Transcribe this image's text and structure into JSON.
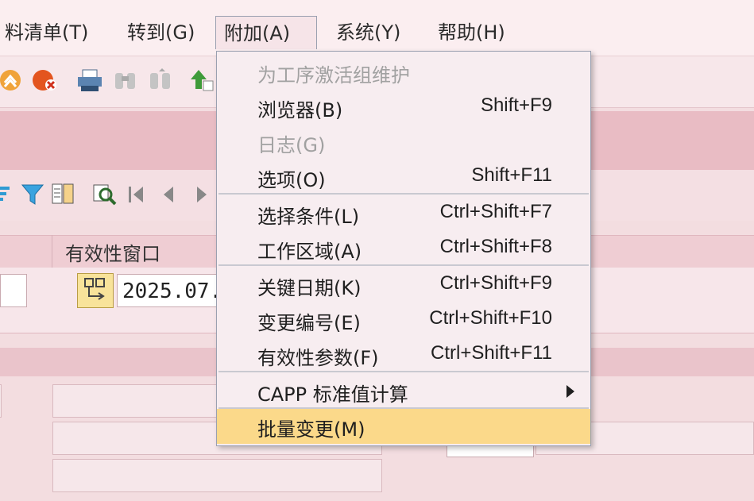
{
  "menubar": {
    "items": [
      {
        "label": "料清单(T)"
      },
      {
        "label": "转到(G)"
      },
      {
        "label": "附加(A)"
      },
      {
        "label": "系统(Y)"
      },
      {
        "label": "帮助(H)"
      }
    ]
  },
  "header": {
    "column": "有效性窗口"
  },
  "data_row": {
    "date_value": "2025.07."
  },
  "dropdown": {
    "items": [
      {
        "label": "为工序激活组维护",
        "shortcut": ""
      },
      {
        "label": "浏览器(B)",
        "shortcut": "Shift+F9"
      },
      {
        "label": "日志(G)",
        "shortcut": ""
      },
      {
        "label": "选项(O)",
        "shortcut": "Shift+F11"
      },
      {
        "label": "选择条件(L)",
        "shortcut": "Ctrl+Shift+F7"
      },
      {
        "label": "工作区域(A)",
        "shortcut": "Ctrl+Shift+F8"
      },
      {
        "label": "关键日期(K)",
        "shortcut": "Ctrl+Shift+F9"
      },
      {
        "label": "变更编号(E)",
        "shortcut": "Ctrl+Shift+F10"
      },
      {
        "label": "有效性参数(F)",
        "shortcut": "Ctrl+Shift+F11"
      },
      {
        "label": "CAPP 标准值计算",
        "shortcut": ""
      },
      {
        "label": "批量变更(M)",
        "shortcut": ""
      }
    ]
  },
  "colors": {
    "accent": "#2f6fd1",
    "highlight": "#fbd98a",
    "band": "#e9bcc4",
    "matrix_button": "#f8e39a"
  },
  "icons": [
    "hierarchy-icon",
    "cancel-icon",
    "print-icon",
    "find-icon",
    "find-next-icon",
    "upload-icon",
    "sort-icon",
    "filter-icon",
    "layout-icon",
    "search-detail-icon",
    "first-page-icon",
    "prev-page-icon",
    "next-page-icon",
    "matrix-icon",
    "submenu-arrow-icon"
  ]
}
